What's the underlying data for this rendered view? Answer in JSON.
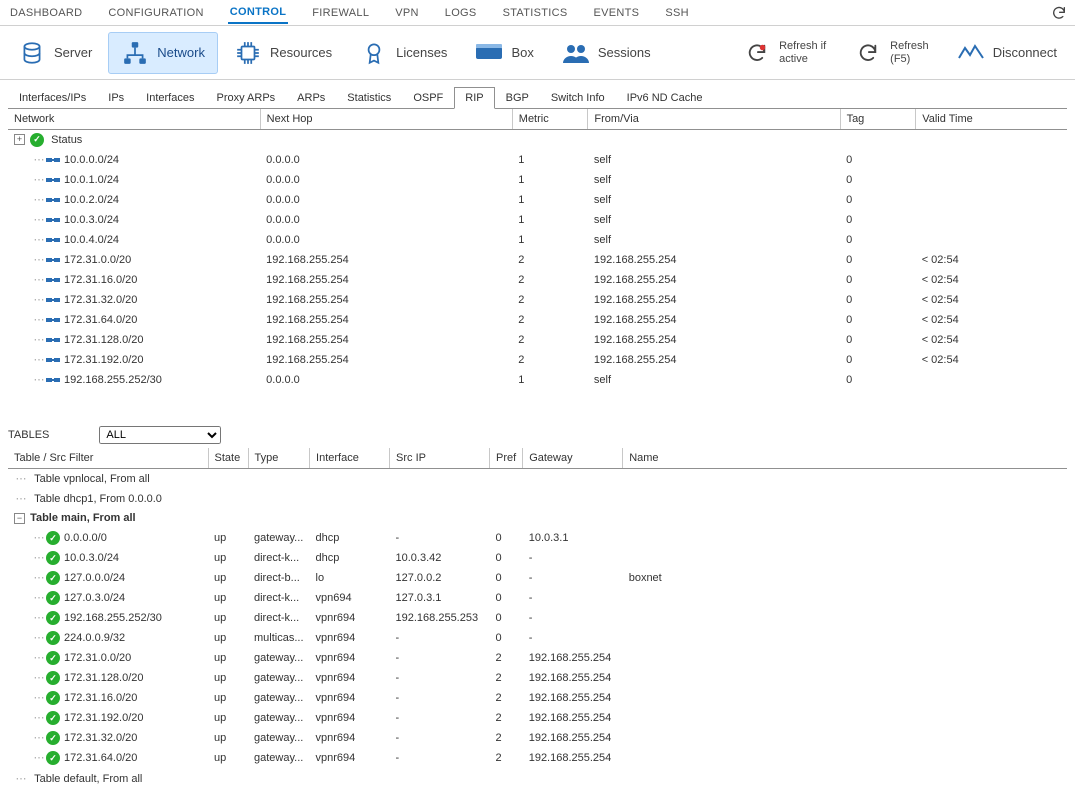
{
  "topnav": {
    "tabs": [
      "DASHBOARD",
      "CONFIGURATION",
      "CONTROL",
      "FIREWALL",
      "VPN",
      "LOGS",
      "STATISTICS",
      "EVENTS",
      "SSH"
    ],
    "active": "CONTROL"
  },
  "toolbar": {
    "server": "Server",
    "network": "Network",
    "resources": "Resources",
    "licenses": "Licenses",
    "box": "Box",
    "sessions": "Sessions",
    "refresh_if_active_l1": "Refresh if",
    "refresh_if_active_l2": "active",
    "refresh_l1": "Refresh",
    "refresh_l2": "(F5)",
    "disconnect": "Disconnect"
  },
  "subtabs": {
    "items": [
      "Interfaces/IPs",
      "IPs",
      "Interfaces",
      "Proxy ARPs",
      "ARPs",
      "Statistics",
      "OSPF",
      "RIP",
      "BGP",
      "Switch Info",
      "IPv6 ND Cache"
    ],
    "active": "RIP"
  },
  "rip_table": {
    "headers": [
      "Network",
      "Next Hop",
      "Metric",
      "From/Via",
      "Tag",
      "Valid Time"
    ],
    "status_label": "Status",
    "rows": [
      {
        "net": "10.0.0.0/24",
        "hop": "0.0.0.0",
        "metric": "1",
        "from": "self",
        "tag": "0",
        "valid": ""
      },
      {
        "net": "10.0.1.0/24",
        "hop": "0.0.0.0",
        "metric": "1",
        "from": "self",
        "tag": "0",
        "valid": ""
      },
      {
        "net": "10.0.2.0/24",
        "hop": "0.0.0.0",
        "metric": "1",
        "from": "self",
        "tag": "0",
        "valid": ""
      },
      {
        "net": "10.0.3.0/24",
        "hop": "0.0.0.0",
        "metric": "1",
        "from": "self",
        "tag": "0",
        "valid": ""
      },
      {
        "net": "10.0.4.0/24",
        "hop": "0.0.0.0",
        "metric": "1",
        "from": "self",
        "tag": "0",
        "valid": ""
      },
      {
        "net": "172.31.0.0/20",
        "hop": "192.168.255.254",
        "metric": "2",
        "from": "192.168.255.254",
        "tag": "0",
        "valid": "< 02:54"
      },
      {
        "net": "172.31.16.0/20",
        "hop": "192.168.255.254",
        "metric": "2",
        "from": "192.168.255.254",
        "tag": "0",
        "valid": "< 02:54"
      },
      {
        "net": "172.31.32.0/20",
        "hop": "192.168.255.254",
        "metric": "2",
        "from": "192.168.255.254",
        "tag": "0",
        "valid": "< 02:54"
      },
      {
        "net": "172.31.64.0/20",
        "hop": "192.168.255.254",
        "metric": "2",
        "from": "192.168.255.254",
        "tag": "0",
        "valid": "< 02:54"
      },
      {
        "net": "172.31.128.0/20",
        "hop": "192.168.255.254",
        "metric": "2",
        "from": "192.168.255.254",
        "tag": "0",
        "valid": "< 02:54"
      },
      {
        "net": "172.31.192.0/20",
        "hop": "192.168.255.254",
        "metric": "2",
        "from": "192.168.255.254",
        "tag": "0",
        "valid": "< 02:54"
      },
      {
        "net": "192.168.255.252/30",
        "hop": "0.0.0.0",
        "metric": "1",
        "from": "self",
        "tag": "0",
        "valid": ""
      }
    ]
  },
  "tables_filter": {
    "label": "TABLES",
    "selected": "ALL"
  },
  "routes_table": {
    "headers": [
      "Table / Src Filter",
      "State",
      "Type",
      "Interface",
      "Src IP",
      "Pref",
      "Gateway",
      "Name"
    ],
    "group_vpnlocal": "Table vpnlocal, From all",
    "group_dhcp1": "Table dhcp1, From 0.0.0.0",
    "group_main": "Table main, From all",
    "group_default": "Table default, From all",
    "main_rows": [
      {
        "net": "0.0.0.0/0",
        "state": "up",
        "type": "gateway...",
        "iface": "dhcp",
        "src": "-",
        "pref": "0",
        "gw": "10.0.3.1",
        "name": ""
      },
      {
        "net": "10.0.3.0/24",
        "state": "up",
        "type": "direct-k...",
        "iface": "dhcp",
        "src": "10.0.3.42",
        "pref": "0",
        "gw": "-",
        "name": ""
      },
      {
        "net": "127.0.0.0/24",
        "state": "up",
        "type": "direct-b...",
        "iface": "lo",
        "src": "127.0.0.2",
        "pref": "0",
        "gw": "-",
        "name": "boxnet"
      },
      {
        "net": "127.0.3.0/24",
        "state": "up",
        "type": "direct-k...",
        "iface": "vpn694",
        "src": "127.0.3.1",
        "pref": "0",
        "gw": "-",
        "name": ""
      },
      {
        "net": "192.168.255.252/30",
        "state": "up",
        "type": "direct-k...",
        "iface": "vpnr694",
        "src": "192.168.255.253",
        "pref": "0",
        "gw": "-",
        "name": ""
      },
      {
        "net": "224.0.0.9/32",
        "state": "up",
        "type": "multicas...",
        "iface": "vpnr694",
        "src": "-",
        "pref": "0",
        "gw": "-",
        "name": ""
      },
      {
        "net": "172.31.0.0/20",
        "state": "up",
        "type": "gateway...",
        "iface": "vpnr694",
        "src": "-",
        "pref": "2",
        "gw": "192.168.255.254",
        "name": ""
      },
      {
        "net": "172.31.128.0/20",
        "state": "up",
        "type": "gateway...",
        "iface": "vpnr694",
        "src": "-",
        "pref": "2",
        "gw": "192.168.255.254",
        "name": ""
      },
      {
        "net": "172.31.16.0/20",
        "state": "up",
        "type": "gateway...",
        "iface": "vpnr694",
        "src": "-",
        "pref": "2",
        "gw": "192.168.255.254",
        "name": ""
      },
      {
        "net": "172.31.192.0/20",
        "state": "up",
        "type": "gateway...",
        "iface": "vpnr694",
        "src": "-",
        "pref": "2",
        "gw": "192.168.255.254",
        "name": ""
      },
      {
        "net": "172.31.32.0/20",
        "state": "up",
        "type": "gateway...",
        "iface": "vpnr694",
        "src": "-",
        "pref": "2",
        "gw": "192.168.255.254",
        "name": ""
      },
      {
        "net": "172.31.64.0/20",
        "state": "up",
        "type": "gateway...",
        "iface": "vpnr694",
        "src": "-",
        "pref": "2",
        "gw": "192.168.255.254",
        "name": ""
      }
    ]
  }
}
